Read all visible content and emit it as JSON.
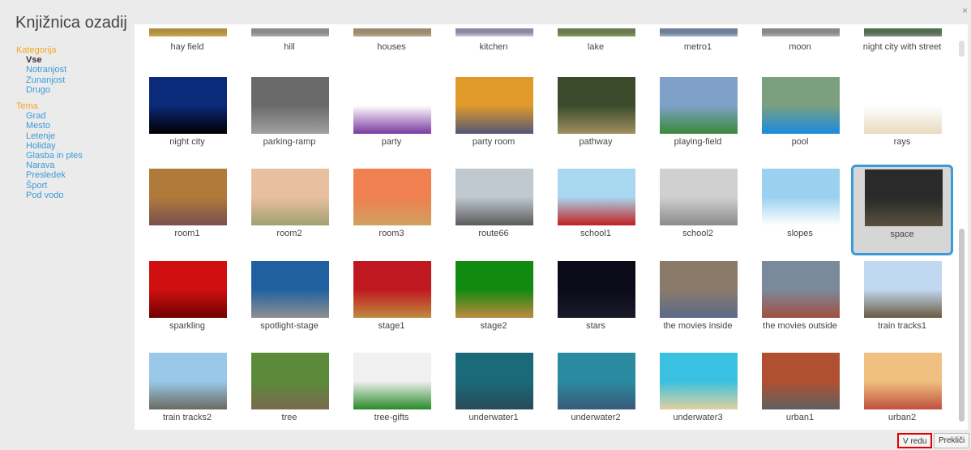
{
  "dialog": {
    "title": "Knjižnica ozadij",
    "close": "×"
  },
  "sidebar": {
    "kategorija": {
      "heading": "Kategorija",
      "items": [
        {
          "label": "Vse",
          "selected": true
        },
        {
          "label": "Notranjost"
        },
        {
          "label": "Zunanjost"
        },
        {
          "label": "Drugo"
        }
      ]
    },
    "tema": {
      "heading": "Tema",
      "items": [
        {
          "label": "Grad"
        },
        {
          "label": "Mesto"
        },
        {
          "label": "Letenje"
        },
        {
          "label": "Holiday"
        },
        {
          "label": "Glasba in ples"
        },
        {
          "label": "Narava"
        },
        {
          "label": "Presledek"
        },
        {
          "label": "Šport"
        },
        {
          "label": "Pod vodo"
        }
      ]
    }
  },
  "backdrops": [
    {
      "name": "hay field",
      "icon": "hay-field-thumbnail",
      "colors": [
        "#b09040",
        "#c8aa55"
      ]
    },
    {
      "name": "hill",
      "icon": "hill-thumbnail",
      "colors": [
        "#8a8a8a",
        "#aaaaaa"
      ]
    },
    {
      "name": "houses",
      "icon": "houses-thumbnail",
      "colors": [
        "#9a8b70",
        "#b8a888"
      ]
    },
    {
      "name": "kitchen",
      "icon": "kitchen-thumbnail",
      "colors": [
        "#8a8aa0",
        "#c9c9d9"
      ]
    },
    {
      "name": "lake",
      "icon": "lake-thumbnail",
      "colors": [
        "#6a7a50",
        "#8a9a60"
      ]
    },
    {
      "name": "metro1",
      "icon": "metro-thumbnail",
      "colors": [
        "#6f7f99",
        "#9fb0c8"
      ]
    },
    {
      "name": "moon",
      "icon": "moon-thumbnail",
      "colors": [
        "#888888",
        "#b0b0b0"
      ]
    },
    {
      "name": "night city with street",
      "icon": "night-city-street-thumbnail",
      "colors": [
        "#4f6f4f",
        "#888888"
      ]
    },
    {
      "name": "night city",
      "icon": "night-city-thumbnail",
      "colors": [
        "#0c2a7a",
        "#000000"
      ]
    },
    {
      "name": "parking-ramp",
      "icon": "parking-ramp-thumbnail",
      "colors": [
        "#6a6a6a",
        "#a0a0a0"
      ]
    },
    {
      "name": "party",
      "icon": "party-thumbnail",
      "colors": [
        "#ffffff",
        "#7a3aa0"
      ]
    },
    {
      "name": "party room",
      "icon": "party-room-thumbnail",
      "colors": [
        "#e09a2a",
        "#555577"
      ]
    },
    {
      "name": "pathway",
      "icon": "pathway-thumbnail",
      "colors": [
        "#3a4a2a",
        "#a09060"
      ]
    },
    {
      "name": "playing-field",
      "icon": "playing-field-thumbnail",
      "colors": [
        "#7fa0c8",
        "#3a8a3a"
      ]
    },
    {
      "name": "pool",
      "icon": "pool-thumbnail",
      "colors": [
        "#7aa080",
        "#1a8adf"
      ]
    },
    {
      "name": "rays",
      "icon": "rays-thumbnail",
      "colors": [
        "#ffffff",
        "#e8dcc0"
      ]
    },
    {
      "name": "room1",
      "icon": "room1-thumbnail",
      "colors": [
        "#b07a3a",
        "#7a5050"
      ]
    },
    {
      "name": "room2",
      "icon": "room2-thumbnail",
      "colors": [
        "#e8c0a0",
        "#a0a070"
      ]
    },
    {
      "name": "room3",
      "icon": "room3-thumbnail",
      "colors": [
        "#f08050",
        "#d0a060"
      ]
    },
    {
      "name": "route66",
      "icon": "route66-thumbnail",
      "colors": [
        "#c0c8d0",
        "#5a5a5a"
      ]
    },
    {
      "name": "school1",
      "icon": "school1-thumbnail",
      "colors": [
        "#a8d8f0",
        "#c02020"
      ]
    },
    {
      "name": "school2",
      "icon": "school2-thumbnail",
      "colors": [
        "#d0d0d0",
        "#8a8a8a"
      ]
    },
    {
      "name": "slopes",
      "icon": "slopes-thumbnail",
      "colors": [
        "#9ad0f0",
        "#ffffff"
      ]
    },
    {
      "name": "space",
      "icon": "space-thumbnail",
      "colors": [
        "#2a2a2a",
        "#5a5040"
      ],
      "selected": true
    },
    {
      "name": "sparkling",
      "icon": "sparkling-thumbnail",
      "colors": [
        "#d01010",
        "#700000"
      ]
    },
    {
      "name": "spotlight-stage",
      "icon": "spotlight-stage-thumbnail",
      "colors": [
        "#2060a0",
        "#909090"
      ]
    },
    {
      "name": "stage1",
      "icon": "stage1-thumbnail",
      "colors": [
        "#c01820",
        "#c08a40"
      ]
    },
    {
      "name": "stage2",
      "icon": "stage2-thumbnail",
      "colors": [
        "#108a10",
        "#c08a40"
      ]
    },
    {
      "name": "stars",
      "icon": "stars-thumbnail",
      "colors": [
        "#0a0a18",
        "#1a1a2a"
      ]
    },
    {
      "name": "the movies inside",
      "icon": "movies-inside-thumbnail",
      "colors": [
        "#8a7a6a",
        "#5a6a8a"
      ]
    },
    {
      "name": "the movies outside",
      "icon": "movies-outside-thumbnail",
      "colors": [
        "#7a8a9a",
        "#a05040"
      ]
    },
    {
      "name": "train tracks1",
      "icon": "train-tracks1-thumbnail",
      "colors": [
        "#c0d8f0",
        "#6a5a40"
      ]
    },
    {
      "name": "train tracks2",
      "icon": "train-tracks2-thumbnail",
      "colors": [
        "#9ac8e8",
        "#6a6a60"
      ]
    },
    {
      "name": "tree",
      "icon": "tree-thumbnail",
      "colors": [
        "#5a8a3a",
        "#7a6a50"
      ]
    },
    {
      "name": "tree-gifts",
      "icon": "tree-gifts-thumbnail",
      "colors": [
        "#f0f0f0",
        "#2a8a2a"
      ]
    },
    {
      "name": "underwater1",
      "icon": "underwater1-thumbnail",
      "colors": [
        "#1a6a7a",
        "#2a4a5a"
      ]
    },
    {
      "name": "underwater2",
      "icon": "underwater2-thumbnail",
      "colors": [
        "#2a8aa0",
        "#3a5a7a"
      ]
    },
    {
      "name": "underwater3",
      "icon": "underwater3-thumbnail",
      "colors": [
        "#3ac0e0",
        "#e0d0a0"
      ]
    },
    {
      "name": "urban1",
      "icon": "urban1-thumbnail",
      "colors": [
        "#b05030",
        "#606060"
      ]
    },
    {
      "name": "urban2",
      "icon": "urban2-thumbnail",
      "colors": [
        "#f0c080",
        "#c05040"
      ]
    }
  ],
  "footer": {
    "ok_label": "V redu",
    "cancel_label": "Prekliči"
  },
  "theme": {
    "accent": "#3a9bd9",
    "heading": "#f5a623",
    "ok_outline": "#e00000"
  }
}
